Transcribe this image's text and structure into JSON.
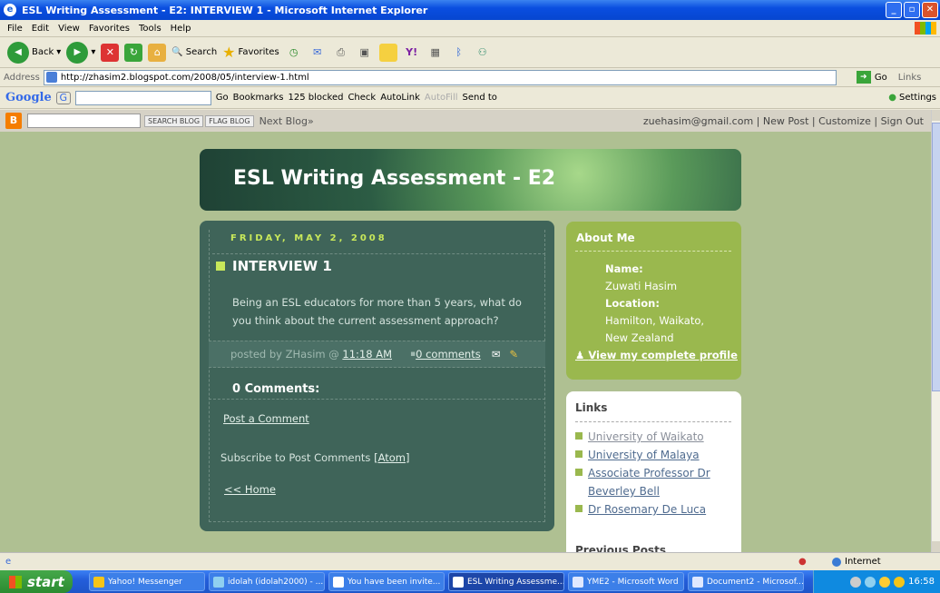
{
  "window": {
    "title": "ESL Writing Assessment - E2: INTERVIEW 1 - Microsoft Internet Explorer"
  },
  "menu": [
    "File",
    "Edit",
    "View",
    "Favorites",
    "Tools",
    "Help"
  ],
  "toolbar": {
    "back": "Back",
    "search": "Search",
    "favorites": "Favorites"
  },
  "address": {
    "label": "Address",
    "url": "http://zhasim2.blogspot.com/2008/05/interview-1.html",
    "go": "Go",
    "links": "Links"
  },
  "google": {
    "logo": "Google",
    "go": "Go",
    "bookmarks": "Bookmarks",
    "blocked": "125 blocked",
    "check": "Check",
    "autolink": "AutoLink",
    "autofill": "AutoFill",
    "sendto": "Send to",
    "settings": "Settings"
  },
  "blogger": {
    "search_blog": "SEARCH BLOG",
    "flag_blog": "FLAG BLOG",
    "next_blog": "Next Blog»",
    "email": "zuehasim@gmail.com",
    "new_post": "New Post",
    "customize": "Customize",
    "sign_out": "Sign Out"
  },
  "blog": {
    "title": "ESL Writing Assessment - E2",
    "date": "FRIDAY, MAY 2, 2008",
    "post_title": "INTERVIEW 1",
    "post_body": "Being an ESL educators for more than 5 years, what do you think about the current assessment approach?",
    "posted_by": "posted by ZHasim @",
    "time": "11:18 AM",
    "comments_link": "0 comments",
    "comments_heading": "0 Comments:",
    "post_comment": "Post a Comment",
    "subscribe": "Subscribe to Post Comments",
    "atom": "[Atom]",
    "home": "<< Home"
  },
  "about": {
    "heading": "About Me",
    "name_label": "Name:",
    "name": "Zuwati Hasim",
    "location_label": "Location:",
    "location": "Hamilton, Waikato, New Zealand",
    "profile_link": "View my complete profile"
  },
  "links": {
    "heading": "Links",
    "items": [
      "University of Waikato",
      "University of Malaya",
      "Associate Professor Dr Beverley Bell",
      "Dr Rosemary De Luca"
    ],
    "previous_posts": "Previous Posts"
  },
  "status": {
    "zone": "Internet"
  },
  "taskbar": {
    "start": "start",
    "tasks": [
      "Yahoo! Messenger",
      "idolah (idolah2000) - ...",
      "You have been invite...",
      "ESL Writing Assessme...",
      "YME2 - Microsoft Word",
      "Document2 - Microsof..."
    ],
    "time": "16:58"
  }
}
